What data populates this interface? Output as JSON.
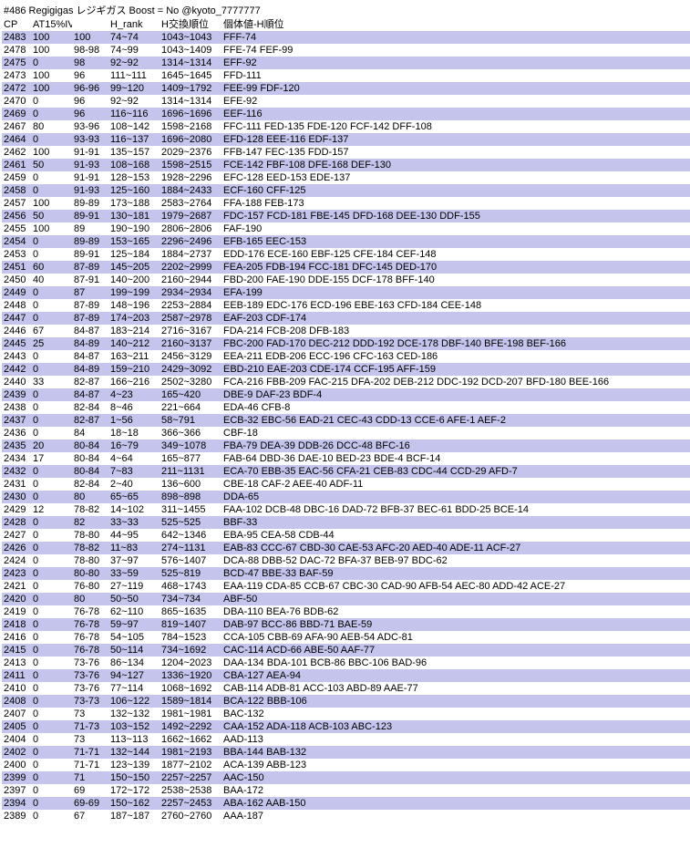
{
  "title": "#486 Regigigas レジギガス Boost = No @kyoto_7777777",
  "headers": {
    "cp": "CP",
    "at": "AT15%IV%",
    "iv": "",
    "hrank": "H_rank",
    "hx": "H交換順位",
    "kv": "個体値-H順位"
  },
  "rows": [
    {
      "cp": "2483",
      "at": "100",
      "iv": "100",
      "hr": "74~74",
      "hx": "1043~1043",
      "kv": "FFF-74"
    },
    {
      "cp": "2478",
      "at": "100",
      "iv": "98-98",
      "hr": "74~99",
      "hx": "1043~1409",
      "kv": "FFE-74 FEF-99"
    },
    {
      "cp": "2475",
      "at": "0",
      "iv": "98",
      "hr": "92~92",
      "hx": "1314~1314",
      "kv": "EFF-92"
    },
    {
      "cp": "2473",
      "at": "100",
      "iv": "96",
      "hr": "111~111",
      "hx": "1645~1645",
      "kv": "FFD-111"
    },
    {
      "cp": "2472",
      "at": "100",
      "iv": "96-96",
      "hr": "99~120",
      "hx": "1409~1792",
      "kv": "FEE-99 FDF-120"
    },
    {
      "cp": "2470",
      "at": "0",
      "iv": "96",
      "hr": "92~92",
      "hx": "1314~1314",
      "kv": "EFE-92"
    },
    {
      "cp": "2469",
      "at": "0",
      "iv": "96",
      "hr": "116~116",
      "hx": "1696~1696",
      "kv": "EEF-116"
    },
    {
      "cp": "2467",
      "at": "80",
      "iv": "93-96",
      "hr": "108~142",
      "hx": "1598~2168",
      "kv": "FFC-111 FED-135 FDE-120 FCF-142 DFF-108"
    },
    {
      "cp": "2464",
      "at": "0",
      "iv": "93-93",
      "hr": "116~137",
      "hx": "1696~2080",
      "kv": "EFD-128 EEE-116 EDF-137"
    },
    {
      "cp": "2462",
      "at": "100",
      "iv": "91-91",
      "hr": "135~157",
      "hx": "2029~2376",
      "kv": "FFB-147 FEC-135 FDD-157"
    },
    {
      "cp": "2461",
      "at": "50",
      "iv": "91-93",
      "hr": "108~168",
      "hx": "1598~2515",
      "kv": "FCE-142 FBF-108 DFE-168 DEF-130"
    },
    {
      "cp": "2459",
      "at": "0",
      "iv": "91-91",
      "hr": "128~153",
      "hx": "1928~2296",
      "kv": "EFC-128 EED-153 EDE-137"
    },
    {
      "cp": "2458",
      "at": "0",
      "iv": "91-93",
      "hr": "125~160",
      "hx": "1884~2433",
      "kv": "ECF-160 CFF-125"
    },
    {
      "cp": "2457",
      "at": "100",
      "iv": "89-89",
      "hr": "173~188",
      "hx": "2583~2764",
      "kv": "FFA-188 FEB-173"
    },
    {
      "cp": "2456",
      "at": "50",
      "iv": "89-91",
      "hr": "130~181",
      "hx": "1979~2687",
      "kv": "FDC-157 FCD-181 FBE-145 DFD-168 DEE-130 DDF-155"
    },
    {
      "cp": "2455",
      "at": "100",
      "iv": "89",
      "hr": "190~190",
      "hx": "2806~2806",
      "kv": "FAF-190"
    },
    {
      "cp": "2454",
      "at": "0",
      "iv": "89-89",
      "hr": "153~165",
      "hx": "2296~2496",
      "kv": "EFB-165 EEC-153"
    },
    {
      "cp": "2453",
      "at": "0",
      "iv": "89-91",
      "hr": "125~184",
      "hx": "1884~2737",
      "kv": "EDD-176 ECE-160 EBF-125 CFE-184 CEF-148"
    },
    {
      "cp": "2451",
      "at": "60",
      "iv": "87-89",
      "hr": "145~205",
      "hx": "2202~2999",
      "kv": "FEA-205 FDB-194 FCC-181 DFC-145 DED-170"
    },
    {
      "cp": "2450",
      "at": "40",
      "iv": "87-91",
      "hr": "140~200",
      "hx": "2160~2944",
      "kv": "FBD-200 FAE-190 DDE-155 DCF-178 BFF-140"
    },
    {
      "cp": "2449",
      "at": "0",
      "iv": "87",
      "hr": "199~199",
      "hx": "2934~2934",
      "kv": "EFA-199"
    },
    {
      "cp": "2448",
      "at": "0",
      "iv": "87-89",
      "hr": "148~196",
      "hx": "2253~2884",
      "kv": "EEB-189 EDC-176 ECD-196 EBE-163 CFD-184 CEE-148"
    },
    {
      "cp": "2447",
      "at": "0",
      "iv": "87-89",
      "hr": "174~203",
      "hx": "2587~2978",
      "kv": "EAF-203 CDF-174"
    },
    {
      "cp": "2446",
      "at": "67",
      "iv": "84-87",
      "hr": "183~214",
      "hx": "2716~3167",
      "kv": "FDA-214 FCB-208 DFB-183"
    },
    {
      "cp": "2445",
      "at": "25",
      "iv": "84-89",
      "hr": "140~212",
      "hx": "2160~3137",
      "kv": "FBC-200 FAD-170 DEC-212 DDD-192 DCE-178 DBF-140 BFE-198 BEF-166"
    },
    {
      "cp": "2443",
      "at": "0",
      "iv": "84-87",
      "hr": "163~211",
      "hx": "2456~3129",
      "kv": "EEA-211 EDB-206 ECC-196 CFC-163 CED-186"
    },
    {
      "cp": "2442",
      "at": "0",
      "iv": "84-89",
      "hr": "159~210",
      "hx": "2429~3092",
      "kv": "EBD-210 EAE-203 CDE-174 CCF-195 AFF-159"
    },
    {
      "cp": "2440",
      "at": "33",
      "iv": "82-87",
      "hr": "166~216",
      "hx": "2502~3280",
      "kv": "FCA-216 FBB-209 FAC-215 DFA-202 DEB-212 DDC-192 DCD-207 BFD-180 BEE-166"
    },
    {
      "cp": "2439",
      "at": "0",
      "iv": "84-87",
      "hr": "4~23",
      "hx": "165~420",
      "kv": "DBE-9 DAF-23 BDF-4"
    },
    {
      "cp": "2438",
      "at": "0",
      "iv": "82-84",
      "hr": "8~46",
      "hx": "221~664",
      "kv": "EDA-46 CFB-8"
    },
    {
      "cp": "2437",
      "at": "0",
      "iv": "82-87",
      "hr": "1~56",
      "hx": "58~791",
      "kv": "ECB-32 EBC-56 EAD-21 CEC-43 CDD-13 CCE-6 AFE-1 AEF-2"
    },
    {
      "cp": "2436",
      "at": "0",
      "iv": "84",
      "hr": "18~18",
      "hx": "366~366",
      "kv": "CBF-18"
    },
    {
      "cp": "2435",
      "at": "20",
      "iv": "80-84",
      "hr": "16~79",
      "hx": "349~1078",
      "kv": "FBA-79 DEA-39 DDB-26 DCC-48 BFC-16"
    },
    {
      "cp": "2434",
      "at": "17",
      "iv": "80-84",
      "hr": "4~64",
      "hx": "165~877",
      "kv": "FAB-64 DBD-36 DAE-10 BED-23 BDE-4 BCF-14"
    },
    {
      "cp": "2432",
      "at": "0",
      "iv": "80-84",
      "hr": "7~83",
      "hx": "211~1131",
      "kv": "ECA-70 EBB-35 EAC-56 CFA-21 CEB-83 CDC-44 CCD-29 AFD-7"
    },
    {
      "cp": "2431",
      "at": "0",
      "iv": "82-84",
      "hr": "2~40",
      "hx": "136~600",
      "kv": "CBE-18 CAF-2 AEE-40 ADF-11"
    },
    {
      "cp": "2430",
      "at": "0",
      "iv": "80",
      "hr": "65~65",
      "hx": "898~898",
      "kv": "DDA-65"
    },
    {
      "cp": "2429",
      "at": "12",
      "iv": "78-82",
      "hr": "14~102",
      "hx": "311~1455",
      "kv": "FAA-102 DCB-48 DBC-16 DAD-72 BFB-37 BEC-61 BDD-25 BCE-14"
    },
    {
      "cp": "2428",
      "at": "0",
      "iv": "82",
      "hr": "33~33",
      "hx": "525~525",
      "kv": "BBF-33"
    },
    {
      "cp": "2427",
      "at": "0",
      "iv": "78-80",
      "hr": "44~95",
      "hx": "642~1346",
      "kv": "EBA-95 CEA-58 CDB-44"
    },
    {
      "cp": "2426",
      "at": "0",
      "iv": "78-82",
      "hr": "11~83",
      "hx": "274~1131",
      "kv": "EAB-83 CCC-67 CBD-30 CAE-53 AFC-20 AED-40 ADE-11 ACF-27"
    },
    {
      "cp": "2424",
      "at": "0",
      "iv": "78-80",
      "hr": "37~97",
      "hx": "576~1407",
      "kv": "DCA-88 DBB-52 DAC-72 BFA-37 BEB-97 BDC-62"
    },
    {
      "cp": "2423",
      "at": "0",
      "iv": "80-80",
      "hr": "33~59",
      "hx": "525~819",
      "kv": "BCD-47 BBE-33 BAF-59"
    },
    {
      "cp": "2421",
      "at": "0",
      "iv": "76-80",
      "hr": "27~119",
      "hx": "468~1743",
      "kv": "EAA-119 CDA-85 CCB-67 CBC-30 CAD-90 AFB-54 AEC-80 ADD-42 ACE-27"
    },
    {
      "cp": "2420",
      "at": "0",
      "iv": "80",
      "hr": "50~50",
      "hx": "734~734",
      "kv": "ABF-50"
    },
    {
      "cp": "2419",
      "at": "0",
      "iv": "76-78",
      "hr": "62~110",
      "hx": "865~1635",
      "kv": "DBA-110 BEA-76 BDB-62"
    },
    {
      "cp": "2418",
      "at": "0",
      "iv": "76-78",
      "hr": "59~97",
      "hx": "819~1407",
      "kv": "DAB-97 BCC-86 BBD-71 BAE-59"
    },
    {
      "cp": "2416",
      "at": "0",
      "iv": "76-78",
      "hr": "54~105",
      "hx": "784~1523",
      "kv": "CCA-105 CBB-69 AFA-90 AEB-54 ADC-81"
    },
    {
      "cp": "2415",
      "at": "0",
      "iv": "76-78",
      "hr": "50~114",
      "hx": "734~1692",
      "kv": "CAC-114 ACD-66 ABE-50 AAF-77"
    },
    {
      "cp": "2413",
      "at": "0",
      "iv": "73-76",
      "hr": "86~134",
      "hx": "1204~2023",
      "kv": "DAA-134 BDA-101 BCB-86 BBC-106 BAD-96"
    },
    {
      "cp": "2411",
      "at": "0",
      "iv": "73-76",
      "hr": "94~127",
      "hx": "1336~1920",
      "kv": "CBA-127 AEA-94"
    },
    {
      "cp": "2410",
      "at": "0",
      "iv": "73-76",
      "hr": "77~114",
      "hx": "1068~1692",
      "kv": "CAB-114 ADB-81 ACC-103 ABD-89 AAE-77"
    },
    {
      "cp": "2408",
      "at": "0",
      "iv": "73-73",
      "hr": "106~122",
      "hx": "1589~1814",
      "kv": "BCA-122 BBB-106"
    },
    {
      "cp": "2407",
      "at": "0",
      "iv": "73",
      "hr": "132~132",
      "hx": "1981~1981",
      "kv": "BAC-132"
    },
    {
      "cp": "2405",
      "at": "0",
      "iv": "71-73",
      "hr": "103~152",
      "hx": "1492~2292",
      "kv": "CAA-152 ADA-118 ACB-103 ABC-123"
    },
    {
      "cp": "2404",
      "at": "0",
      "iv": "73",
      "hr": "113~113",
      "hx": "1662~1662",
      "kv": "AAD-113"
    },
    {
      "cp": "2402",
      "at": "0",
      "iv": "71-71",
      "hr": "132~144",
      "hx": "1981~2193",
      "kv": "BBA-144 BAB-132"
    },
    {
      "cp": "2400",
      "at": "0",
      "iv": "71-71",
      "hr": "123~139",
      "hx": "1877~2102",
      "kv": "ACA-139 ABB-123"
    },
    {
      "cp": "2399",
      "at": "0",
      "iv": "71",
      "hr": "150~150",
      "hx": "2257~2257",
      "kv": "AAC-150"
    },
    {
      "cp": "2397",
      "at": "0",
      "iv": "69",
      "hr": "172~172",
      "hx": "2538~2538",
      "kv": "BAA-172"
    },
    {
      "cp": "2394",
      "at": "0",
      "iv": "69-69",
      "hr": "150~162",
      "hx": "2257~2453",
      "kv": "ABA-162 AAB-150"
    },
    {
      "cp": "2389",
      "at": "0",
      "iv": "67",
      "hr": "187~187",
      "hx": "2760~2760",
      "kv": "AAA-187"
    }
  ]
}
